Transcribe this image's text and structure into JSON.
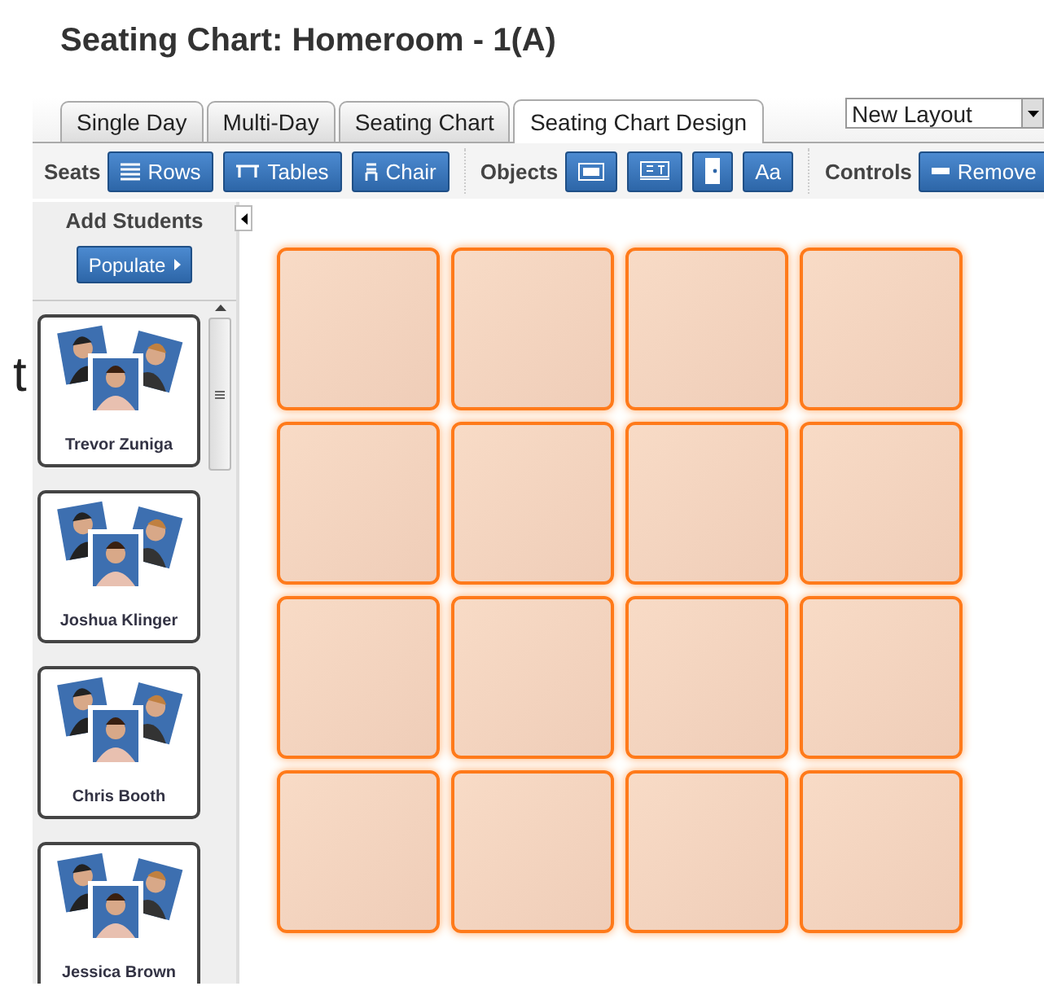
{
  "title": "Seating Chart: Homeroom - 1(A)",
  "tabs": [
    {
      "label": "Single Day",
      "selected": false
    },
    {
      "label": "Multi-Day",
      "selected": false
    },
    {
      "label": "Seating Chart",
      "selected": false
    },
    {
      "label": "Seating Chart Design",
      "selected": true
    }
  ],
  "layout_select": {
    "value": "New Layout"
  },
  "toolbar": [
    {
      "label": "Seats",
      "buttons": [
        {
          "kind": "rows",
          "label": "Rows"
        },
        {
          "kind": "tables",
          "label": "Tables"
        },
        {
          "kind": "chair",
          "label": "Chair"
        }
      ]
    },
    {
      "label": "Objects",
      "buttons": [
        {
          "kind": "board"
        },
        {
          "kind": "podium"
        },
        {
          "kind": "door"
        },
        {
          "kind": "text",
          "label": "Aa"
        }
      ]
    },
    {
      "label": "Controls",
      "buttons": [
        {
          "kind": "remove",
          "label": "Remove"
        }
      ]
    }
  ],
  "sidebar": {
    "heading": "Add Students",
    "populate_button": "Populate",
    "students": [
      {
        "name": "Trevor Zuniga"
      },
      {
        "name": "Joshua Klinger"
      },
      {
        "name": "Chris Booth"
      },
      {
        "name": "Jessica Brown"
      }
    ]
  },
  "stray_text": "t",
  "seats": [
    {
      "kind": "seat"
    },
    {
      "kind": "seat"
    },
    {
      "kind": "seat"
    },
    {
      "kind": "seat"
    },
    {
      "kind": "seat"
    },
    {
      "kind": "seat"
    },
    {
      "kind": "seat"
    },
    {
      "kind": "seat"
    },
    {
      "kind": "seat"
    },
    {
      "kind": "seat"
    },
    {
      "kind": "seat"
    },
    {
      "kind": "seat"
    },
    {
      "kind": "seat"
    },
    {
      "kind": "seat"
    },
    {
      "kind": "seat"
    },
    {
      "kind": "seat"
    }
  ]
}
